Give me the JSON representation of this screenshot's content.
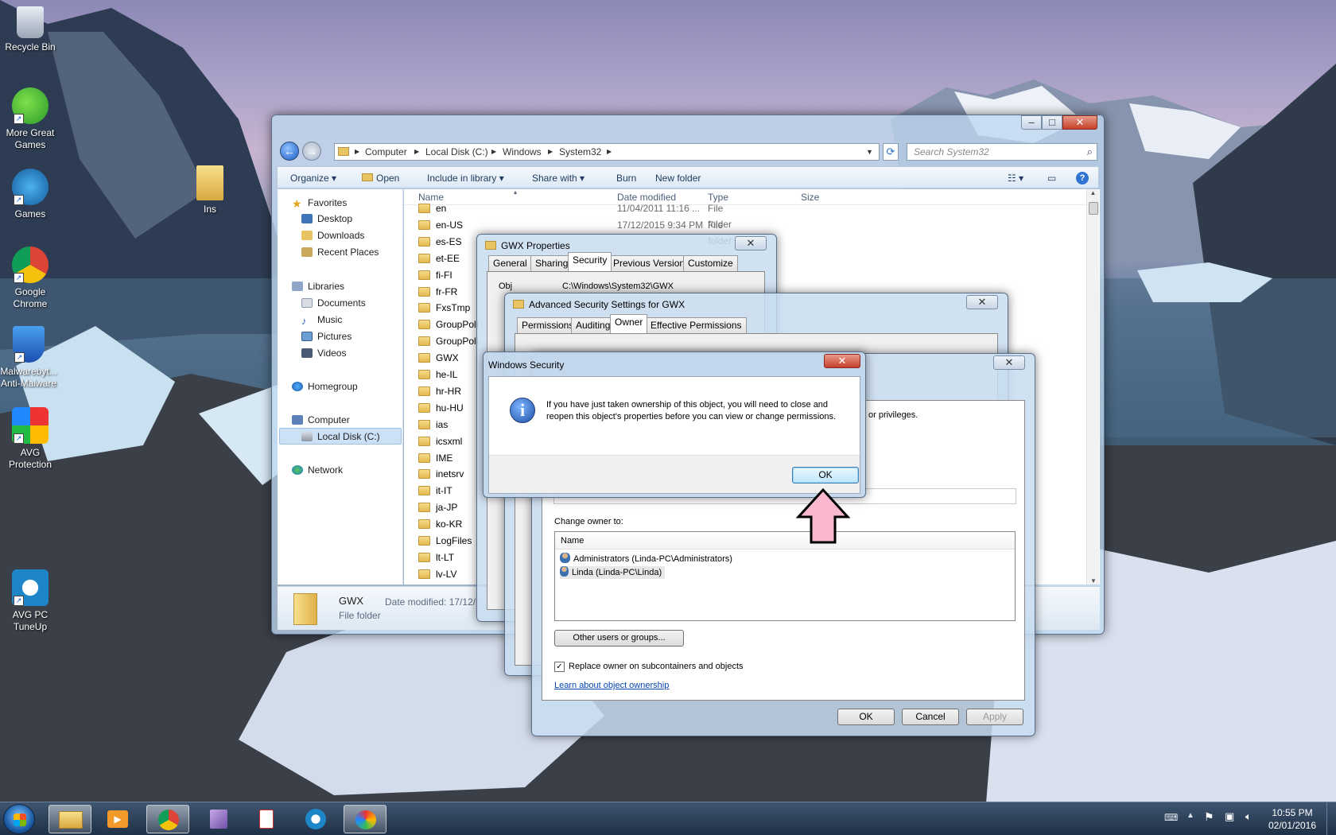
{
  "desktop_icons": [
    {
      "label": "Recycle Bin"
    },
    {
      "label": "More Great Games"
    },
    {
      "label": "Games"
    },
    {
      "label": "Ins"
    },
    {
      "label": "Google Chrome"
    },
    {
      "label": "Malwarebyt... Anti-Malware"
    },
    {
      "label": "AVG Protection"
    },
    {
      "label": "AVG PC TuneUp"
    }
  ],
  "explorer": {
    "breadcrumb": [
      "Computer",
      "Local Disk (C:)",
      "Windows",
      "System32"
    ],
    "search_placeholder": "Search System32",
    "toolbar": {
      "organize": "Organize",
      "open": "Open",
      "include": "Include in library",
      "share": "Share with",
      "burn": "Burn",
      "new_folder": "New folder"
    },
    "nav": {
      "favorites": "Favorites",
      "favorites_items": [
        "Desktop",
        "Downloads",
        "Recent Places"
      ],
      "libraries": "Libraries",
      "libraries_items": [
        "Documents",
        "Music",
        "Pictures",
        "Videos"
      ],
      "homegroup": "Homegroup",
      "computer": "Computer",
      "local_disk": "Local Disk (C:)",
      "network": "Network"
    },
    "columns": {
      "name": "Name",
      "date": "Date modified",
      "type": "Type",
      "size": "Size"
    },
    "rows": [
      {
        "name": "en",
        "date": "11/04/2011 11:16 ...",
        "type": "File folder"
      },
      {
        "name": "en-US",
        "date": "17/12/2015 9:34 PM",
        "type": "File folder"
      },
      {
        "name": "es-ES",
        "date": "",
        "type": ""
      },
      {
        "name": "et-EE",
        "date": "",
        "type": ""
      },
      {
        "name": "fi-FI",
        "date": "",
        "type": ""
      },
      {
        "name": "fr-FR",
        "date": "",
        "type": ""
      },
      {
        "name": "FxsTmp",
        "date": "",
        "type": ""
      },
      {
        "name": "GroupPoli",
        "date": "",
        "type": ""
      },
      {
        "name": "GroupPoli",
        "date": "",
        "type": ""
      },
      {
        "name": "GWX",
        "date": "",
        "type": ""
      },
      {
        "name": "he-IL",
        "date": "",
        "type": ""
      },
      {
        "name": "hr-HR",
        "date": "",
        "type": ""
      },
      {
        "name": "hu-HU",
        "date": "",
        "type": ""
      },
      {
        "name": "ias",
        "date": "",
        "type": ""
      },
      {
        "name": "icsxml",
        "date": "",
        "type": ""
      },
      {
        "name": "IME",
        "date": "",
        "type": ""
      },
      {
        "name": "inetsrv",
        "date": "",
        "type": ""
      },
      {
        "name": "it-IT",
        "date": "",
        "type": ""
      },
      {
        "name": "ja-JP",
        "date": "",
        "type": ""
      },
      {
        "name": "ko-KR",
        "date": "",
        "type": ""
      },
      {
        "name": "LogFiles",
        "date": "",
        "type": ""
      },
      {
        "name": "lt-LT",
        "date": "",
        "type": ""
      },
      {
        "name": "lv-LV",
        "date": "",
        "type": ""
      }
    ],
    "details": {
      "name": "GWX",
      "date_label": "Date modified: 17/12/",
      "kind": "File folder"
    }
  },
  "gwx_props": {
    "title": "GWX Properties",
    "tabs": [
      "General",
      "Sharing",
      "Security",
      "Previous Versions",
      "Customize"
    ],
    "object_label": "Obj",
    "object_value": "C:\\Windows\\System32\\GWX"
  },
  "adv": {
    "title": "Advanced Security Settings for GWX",
    "tabs": [
      "Permissions",
      "Auditing",
      "Owner",
      "Effective Permissions"
    ]
  },
  "owner": {
    "privileges_text": "or privileges.",
    "change_owner_label": "Change owner to:",
    "name_header": "Name",
    "owners": [
      "Administrators (Linda-PC\\Administrators)",
      "Linda (Linda-PC\\Linda)"
    ],
    "other_users_btn": "Other users or groups...",
    "replace_label": "Replace owner on subcontainers and objects",
    "learn_link": "Learn about object ownership",
    "ok": "OK",
    "cancel": "Cancel",
    "apply": "Apply"
  },
  "security_dialog": {
    "title": "Windows Security",
    "message": "If you have just taken ownership of this object, you will need to close and reopen this object's properties before you can view or change permissions.",
    "ok": "OK"
  },
  "taskbar": {
    "time": "10:55 PM",
    "date": "02/01/2016"
  },
  "colors": {
    "arrow": "#f9b8cf",
    "link": "#0645ad"
  }
}
